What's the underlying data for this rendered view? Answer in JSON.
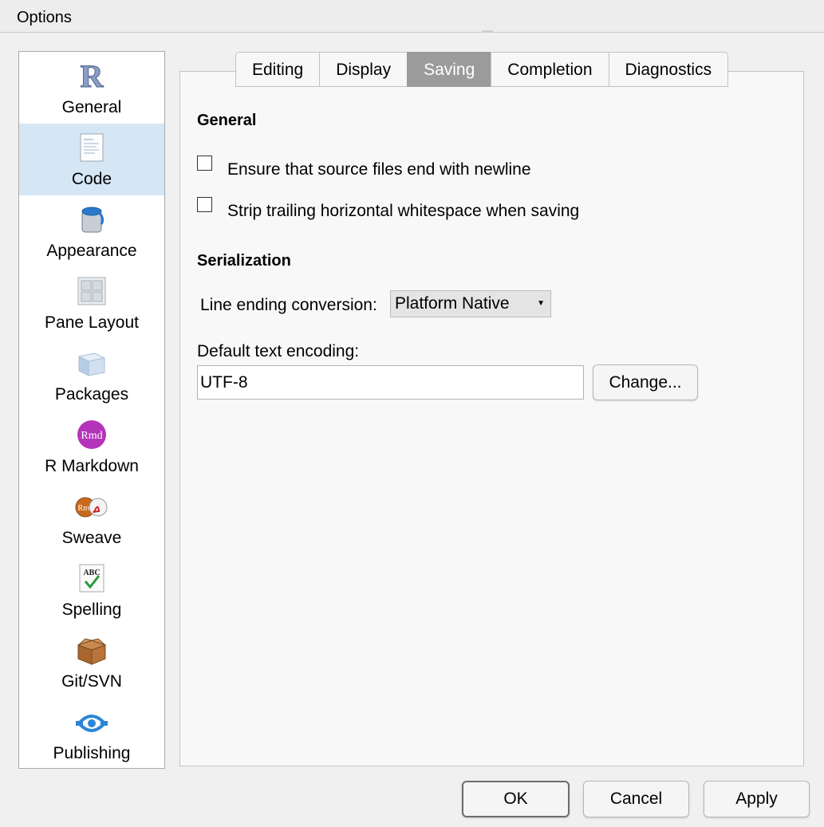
{
  "window": {
    "title": "Options"
  },
  "sidebar": {
    "items": [
      {
        "label": "General",
        "icon": "r-logo-icon"
      },
      {
        "label": "Code",
        "icon": "code-document-icon",
        "selected": true
      },
      {
        "label": "Appearance",
        "icon": "paint-bucket-icon"
      },
      {
        "label": "Pane Layout",
        "icon": "pane-grid-icon"
      },
      {
        "label": "Packages",
        "icon": "package-box-icon"
      },
      {
        "label": "R Markdown",
        "icon": "rmd-icon",
        "icon_text": "Rmd"
      },
      {
        "label": "Sweave",
        "icon": "sweave-pdf-icon",
        "icon_text": "Rnw"
      },
      {
        "label": "Spelling",
        "icon": "spelling-check-icon",
        "icon_text": "ABC"
      },
      {
        "label": "Git/SVN",
        "icon": "git-box-icon"
      },
      {
        "label": "Publishing",
        "icon": "publishing-icon"
      }
    ]
  },
  "tabs": [
    {
      "label": "Editing"
    },
    {
      "label": "Display"
    },
    {
      "label": "Saving",
      "active": true
    },
    {
      "label": "Completion"
    },
    {
      "label": "Diagnostics"
    }
  ],
  "saving": {
    "general_heading": "General",
    "ensure_newline_label": "Ensure that source files end with newline",
    "ensure_newline_checked": false,
    "strip_whitespace_label": "Strip trailing horizontal whitespace when saving",
    "strip_whitespace_checked": false,
    "serialization_heading": "Serialization",
    "line_ending_label": "Line ending conversion:",
    "line_ending_value": "Platform Native",
    "encoding_label": "Default text encoding:",
    "encoding_value": "UTF-8",
    "change_button": "Change..."
  },
  "footer": {
    "ok": "OK",
    "cancel": "Cancel",
    "apply": "Apply"
  },
  "colors": {
    "selected_sidebar": "#d5e6f5",
    "active_tab": "#9b9b9b",
    "rmd_purple": "#b434b9",
    "publish_blue": "#2b86d8"
  }
}
